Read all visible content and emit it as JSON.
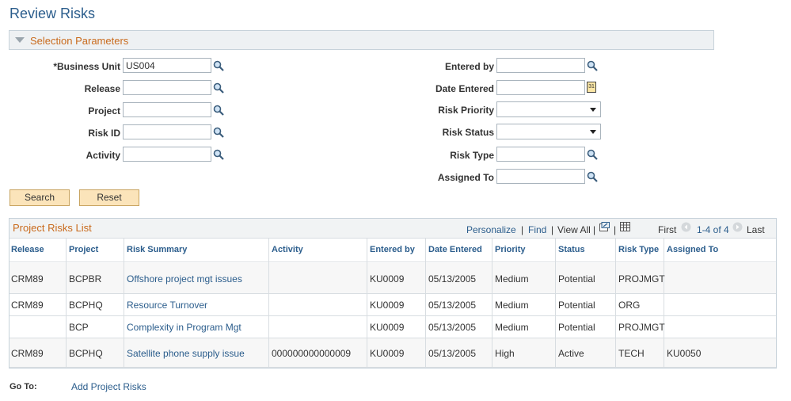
{
  "page": {
    "title": "Review Risks"
  },
  "selection": {
    "section_label": "Selection Parameters",
    "business_unit": {
      "label": "*Business Unit",
      "value": "US004"
    },
    "release": {
      "label": "Release",
      "value": ""
    },
    "project": {
      "label": "Project",
      "value": ""
    },
    "risk_id": {
      "label": "Risk ID",
      "value": ""
    },
    "activity": {
      "label": "Activity",
      "value": ""
    },
    "entered_by": {
      "label": "Entered by",
      "value": ""
    },
    "date_entered": {
      "label": "Date Entered",
      "value": "",
      "cal_glyph": "31"
    },
    "risk_priority": {
      "label": "Risk Priority",
      "value": ""
    },
    "risk_status": {
      "label": "Risk Status",
      "value": ""
    },
    "risk_type": {
      "label": "Risk Type",
      "value": ""
    },
    "assigned_to": {
      "label": "Assigned To",
      "value": ""
    },
    "search_label": "Search",
    "reset_label": "Reset"
  },
  "grid": {
    "title": "Project Risks List",
    "personalize": "Personalize",
    "find": "Find",
    "view_all": "View All",
    "first": "First",
    "range": "1-4 of 4",
    "last": "Last",
    "sep": "|",
    "columns": [
      "Release",
      "Project",
      "Risk Summary",
      "Activity",
      "Entered by",
      "Date Entered",
      "Priority",
      "Status",
      "Risk Type",
      "Assigned To"
    ],
    "rows": [
      [
        "CRM89",
        "BCPBR",
        "Offshore project mgt issues",
        "",
        "KU0009",
        "05/13/2005",
        "Medium",
        "Potential",
        "PROJMGT",
        ""
      ],
      [
        "CRM89",
        "BCPHQ",
        "Resource Turnover",
        "",
        "KU0009",
        "05/13/2005",
        "Medium",
        "Potential",
        "ORG",
        ""
      ],
      [
        "",
        "BCP",
        "Complexity in Program Mgt",
        "",
        "KU0009",
        "05/13/2005",
        "Medium",
        "Potential",
        "PROJMGT",
        ""
      ],
      [
        "CRM89",
        "BCPHQ",
        "Satellite phone supply issue",
        "000000000000009",
        "KU0009",
        "05/13/2005",
        "High",
        "Active",
        "TECH",
        "KU0050"
      ]
    ]
  },
  "goto": {
    "label": "Go To:",
    "link": "Add Project Risks"
  },
  "colors": {
    "link": "#2b5d8c",
    "section_title": "#c96a1c",
    "button_bg": "#fbe4ba"
  }
}
